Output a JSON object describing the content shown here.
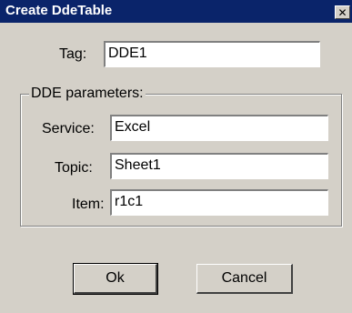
{
  "window": {
    "title": "Create DdeTable",
    "close_icon": "close-icon"
  },
  "tag": {
    "label": "Tag:",
    "value": "DDE1"
  },
  "dde_group": {
    "legend": "DDE parameters:",
    "service": {
      "label": "Service:",
      "value": "Excel"
    },
    "topic": {
      "label": "Topic:",
      "value": "Sheet1"
    },
    "item": {
      "label": "Item:",
      "value": "r1c1"
    }
  },
  "buttons": {
    "ok_label": "Ok",
    "cancel_label": "Cancel"
  }
}
